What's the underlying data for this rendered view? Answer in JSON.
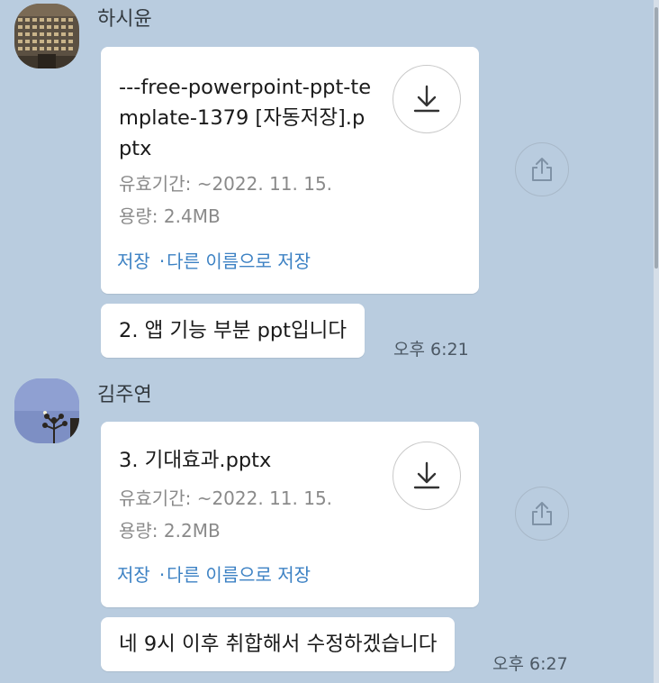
{
  "messages": [
    {
      "sender": "하시윤",
      "file": {
        "name": "---free-powerpoint-ppt-template-1379 [자동저장].pptx",
        "expiry": "유효기간: ~2022. 11. 15.",
        "size": "용량: 2.4MB",
        "save_label": "저장",
        "save_as_label": "다른 이름으로 저장",
        "separator": "·"
      },
      "text": "2. 앱 기능 부분 ppt입니다",
      "time": "오후 6:21"
    },
    {
      "sender": "김주연",
      "file": {
        "name": "3. 기대효과.pptx",
        "expiry": "유효기간: ~2022. 11. 15.",
        "size": "용량: 2.2MB",
        "save_label": "저장",
        "save_as_label": "다른 이름으로 저장",
        "separator": "·"
      },
      "text": "네 9시 이후 취합해서 수정하겠습니다",
      "time": "오후 6:27"
    }
  ],
  "icons": {
    "download": "download-icon",
    "share": "share-icon"
  },
  "colors": {
    "chat_background": "#b9ccdf",
    "link": "#3d82c4",
    "bubble": "#ffffff"
  }
}
